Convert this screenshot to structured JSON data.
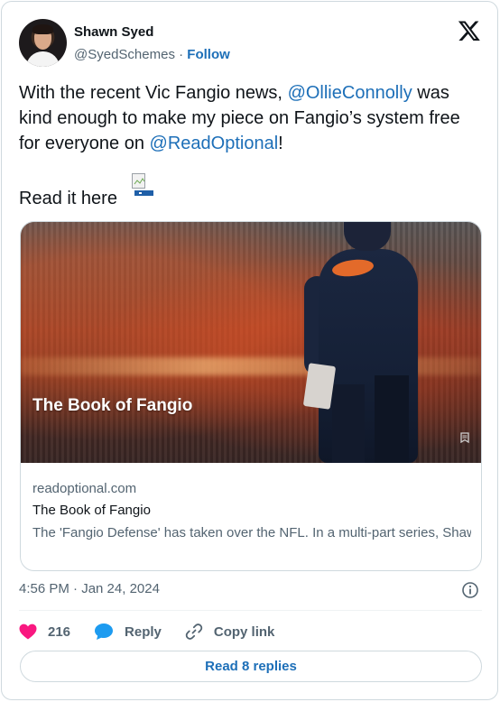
{
  "author": {
    "name": "Shawn Syed",
    "handle": "@SyedSchemes",
    "separator": "·",
    "follow_label": "Follow"
  },
  "tweet": {
    "text_part1": "With the recent Vic Fangio news, ",
    "mention1": "@OllieConnolly",
    "text_part2": " was kind enough to make my piece on Fangio’s system free for everyone on ",
    "mention2": "@ReadOptional",
    "text_part3": "!",
    "read_it_here": "Read it here"
  },
  "card": {
    "image_title": "The Book of Fangio",
    "domain": "readoptional.com",
    "headline": "The Book of Fangio",
    "description": "The 'Fangio Defense' has taken over the NFL. In a multi-part series, Shawn Syed breaks down Fangio's philosophy, core concepts, an…"
  },
  "timestamp": "4:56 PM · Jan 24, 2024",
  "actions": {
    "like_count": "216",
    "reply_label": "Reply",
    "copy_link_label": "Copy link"
  },
  "read_replies_label": "Read 8 replies",
  "colors": {
    "link": "#1d6fb8",
    "heart": "#f91880",
    "reply_bubble": "#1d9bf0",
    "secondary_text": "#536471"
  },
  "icons": [
    "x-logo-icon",
    "broken-image-icon",
    "bookmark-icon",
    "info-icon",
    "heart-icon",
    "reply-bubble-icon",
    "link-icon"
  ]
}
